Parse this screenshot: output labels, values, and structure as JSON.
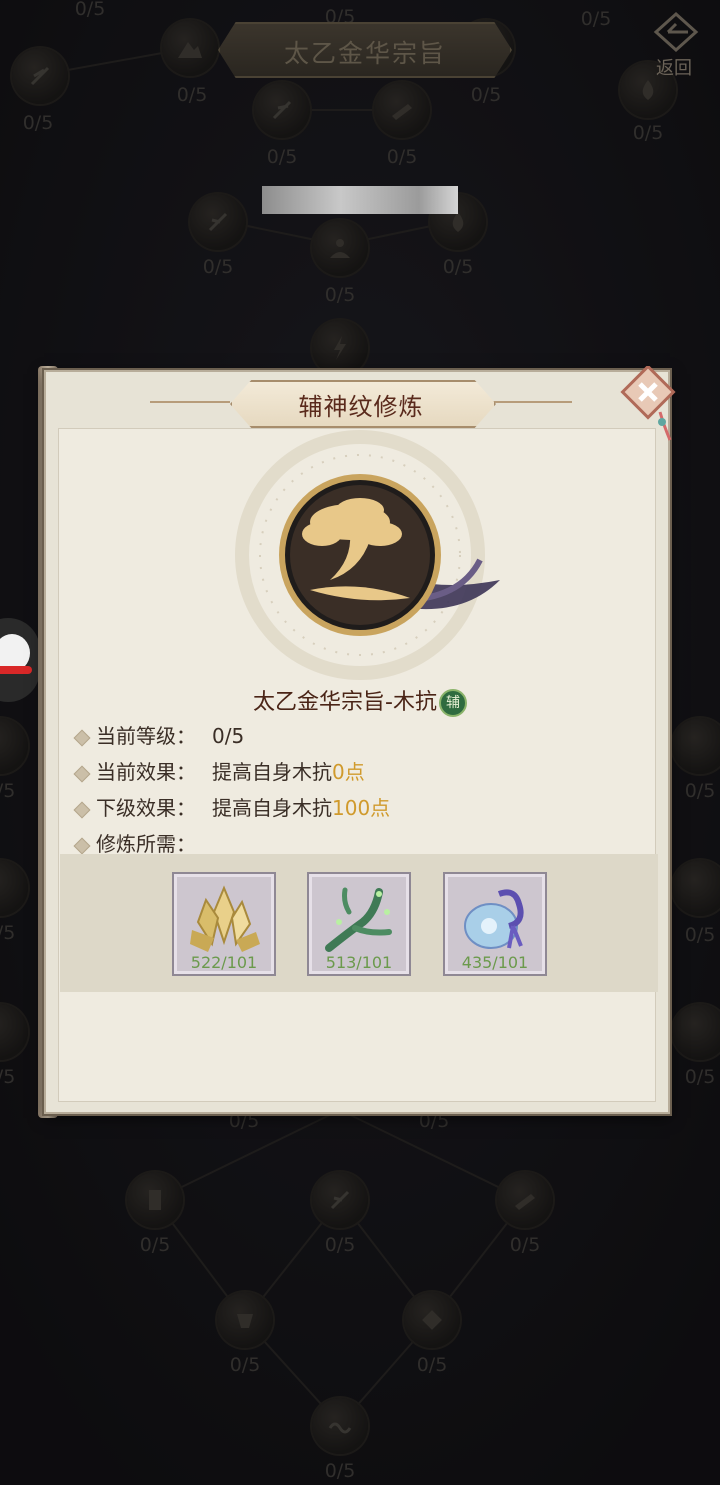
{
  "header": {
    "title": "太乙金华宗旨",
    "back_label": "返回"
  },
  "tree_labels": {
    "l1": "0/5",
    "l2": "0/5",
    "l3": "0/5",
    "l4": "0/5",
    "l5": "0/5",
    "l6": "0/5",
    "l7": "0/5",
    "l8": "0/5",
    "l9": "0/5",
    "l10": "0/5",
    "l11": "0/5",
    "l12": "0/5",
    "l13": "0/5",
    "l14": "0/5",
    "l15": "0/5",
    "l16": "0/5",
    "l17": "0/5",
    "l18": "0/5",
    "l19": "0/5",
    "l20": "0/5",
    "l21": "0/5",
    "l22": "0/5",
    "l23": "0/5",
    "l24": "0/5",
    "l25": "0/5",
    "l26": "0/5",
    "l27": "0/5",
    "l28": "0/5"
  },
  "dialog": {
    "title": "辅神纹修炼",
    "skill_name": "太乙金华宗旨-木抗",
    "badge": "辅",
    "level_label": "当前等级：",
    "level_value": "0/5",
    "current_label": "当前效果：",
    "current_prefix": "提高自身木抗",
    "current_amount": "0点",
    "next_label": "下级效果：",
    "next_prefix": "提高自身木抗",
    "next_amount": "100点",
    "req_label": "修炼所需：",
    "items": [
      {
        "icon": "gold-crystal-icon",
        "count": "522/101"
      },
      {
        "icon": "jade-branch-icon",
        "count": "513/101"
      },
      {
        "icon": "spirit-jade-icon",
        "count": "435/101"
      }
    ]
  },
  "colors": {
    "highlight": "#d09a2c",
    "count_green": "#6b9a4c",
    "title_text": "#5a2a1c"
  }
}
